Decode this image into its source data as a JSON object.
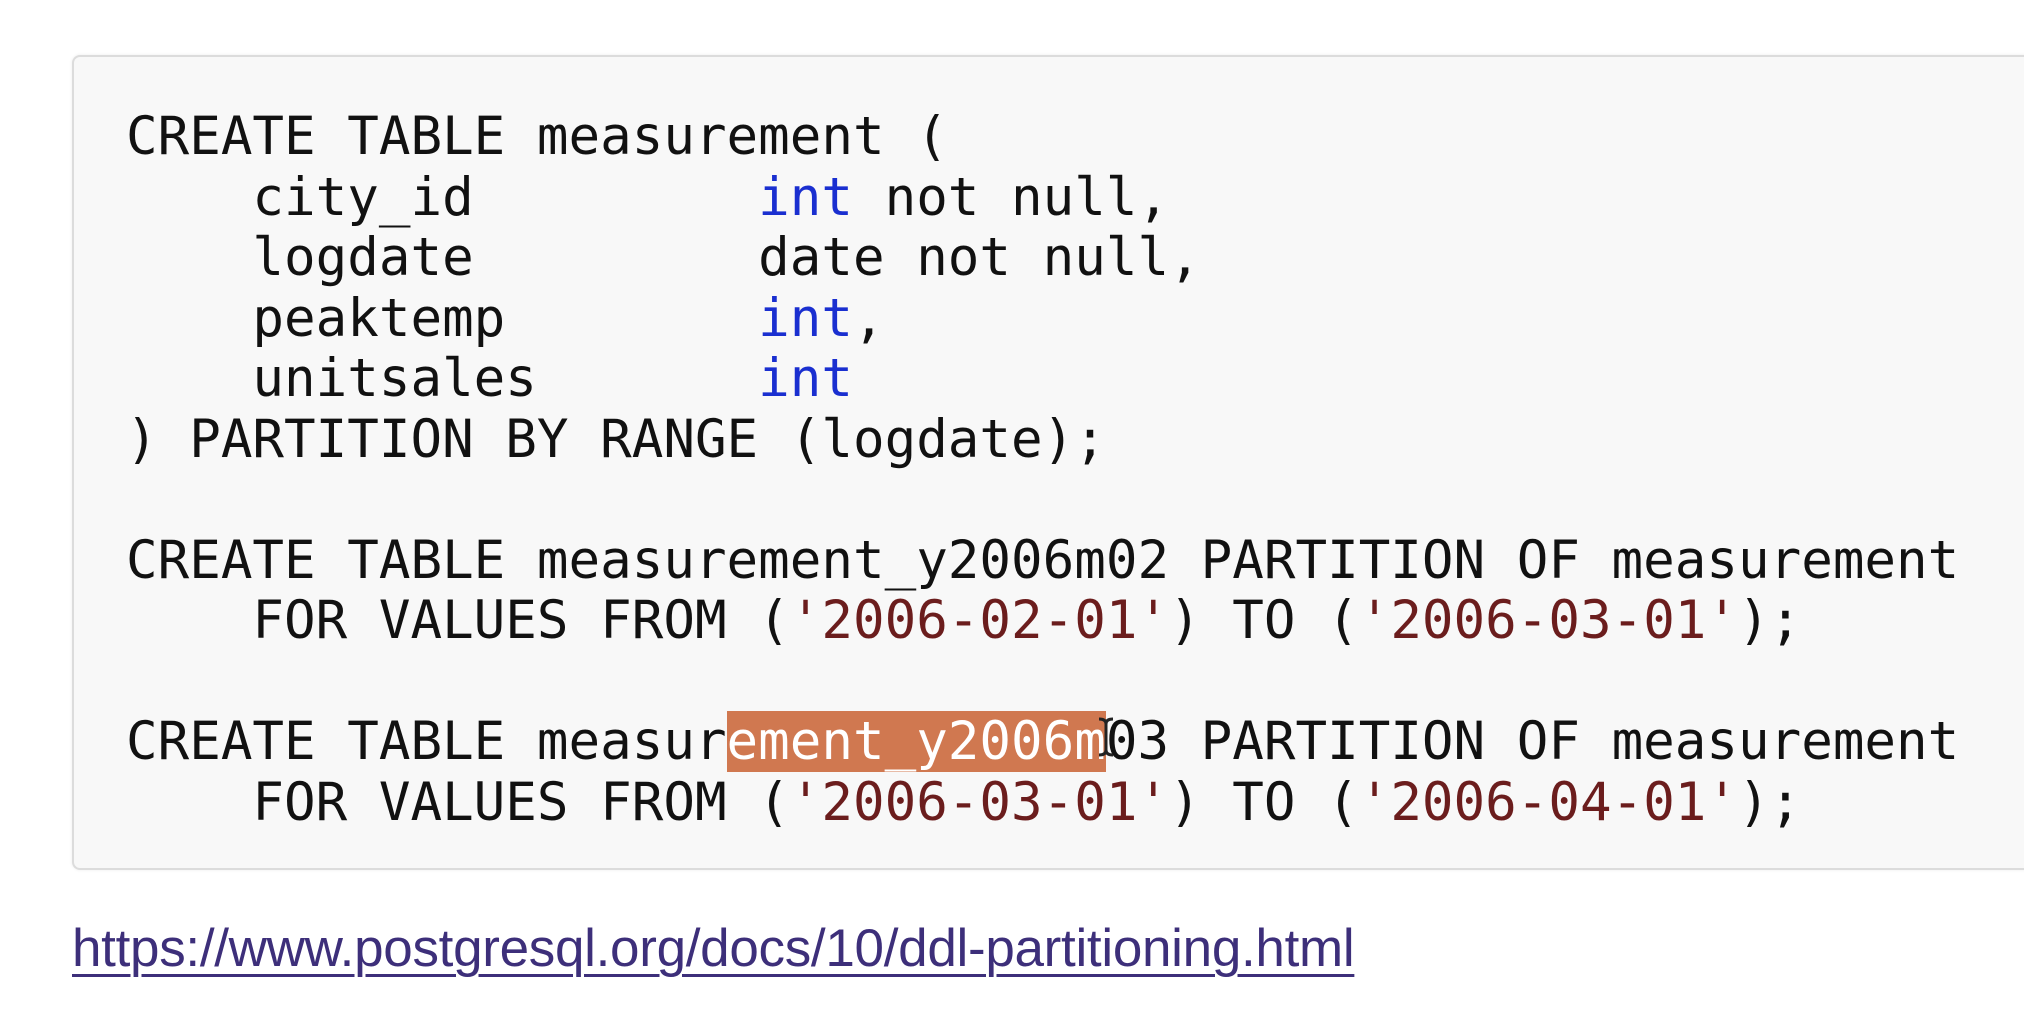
{
  "code_block": {
    "line1": "CREATE TABLE measurement (",
    "line2_ind": "    city_id         ",
    "line2_type": "int",
    "line2_rest": " not null,",
    "line3": "    logdate         date not null,",
    "line4_ind": "    peaktemp        ",
    "line4_type": "int",
    "line4_rest": ",",
    "line5_ind": "    unitsales       ",
    "line5_type": "int",
    "line6": ") PARTITION BY RANGE (logdate);",
    "line8": "CREATE TABLE measurement_y2006m02 PARTITION OF measurement",
    "line9_a": "    FOR VALUES FROM (",
    "line9_from": "'2006-02-01'",
    "line9_b": ") TO (",
    "line9_to": "'2006-03-01'",
    "line9_c": ");",
    "line11_a": "CREATE TABLE measur",
    "line11_sel": "ement_y2006m",
    "line11_b": "03 PARTITION OF measurement",
    "line12_a": "    FOR VALUES FROM (",
    "line12_from": "'2006-03-01'",
    "line12_b": ") TO (",
    "line12_to": "'2006-04-01'",
    "line12_c": ");"
  },
  "link": {
    "text": "https://www.postgresql.org/docs/10/ddl-partitioning.html"
  },
  "colors": {
    "keyword": "#1a2fd0",
    "string": "#6b1d1d",
    "selection": "#d07850",
    "link": "#3d2f7a"
  },
  "icons": {
    "cursor": "text-cursor-icon"
  }
}
